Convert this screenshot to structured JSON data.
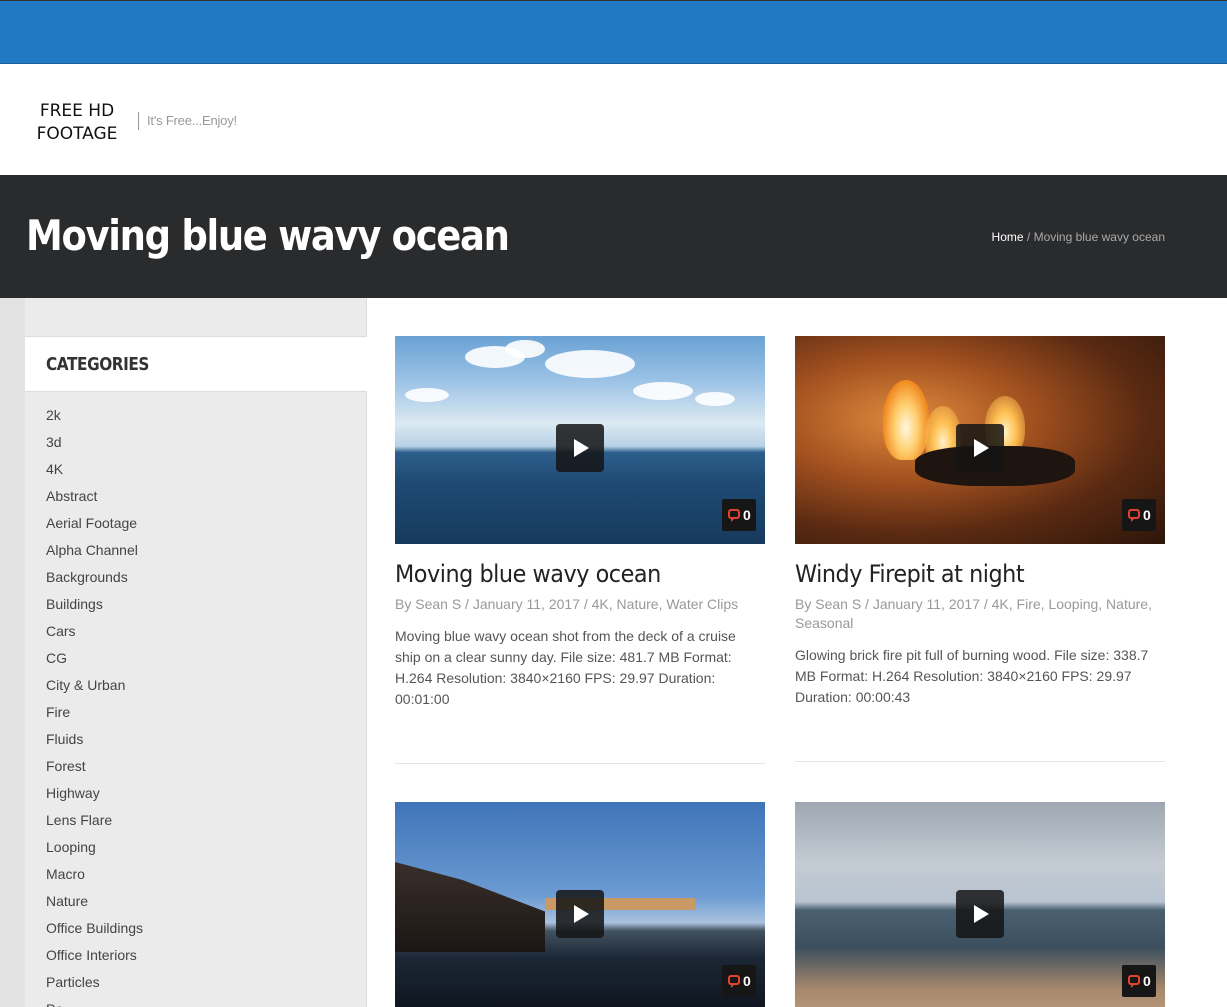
{
  "header": {
    "logo_line1": "FREE HD",
    "logo_line2": "FOOTAGE",
    "tagline": "It's Free...Enjoy!"
  },
  "title_bar": {
    "page_title": "Moving blue wavy ocean",
    "breadcrumb_home": "Home",
    "breadcrumb_separator": " / ",
    "breadcrumb_current": "Moving blue wavy ocean"
  },
  "sidebar": {
    "categories_title": "CATEGORIES",
    "categories": [
      "2k",
      "3d",
      "4K",
      "Abstract",
      "Aerial Footage",
      "Alpha Channel",
      "Backgrounds",
      "Buildings",
      "Cars",
      "CG",
      "City & Urban",
      "Fire",
      "Fluids",
      "Forest",
      "Highway",
      "Lens Flare",
      "Looping",
      "Macro",
      "Nature",
      "Office Buildings",
      "Office Interiors",
      "Particles",
      "Po..."
    ]
  },
  "posts": [
    {
      "title": "Moving blue wavy ocean",
      "meta": "By Sean S / January 11, 2017 / 4K, Nature, Water Clips",
      "description": "Moving blue wavy ocean shot from the deck of a cruise ship on a clear sunny day. File size: 481.7 MB Format: H.264 Resolution: 3840×2160 FPS: 29.97 Duration: 00:01:00",
      "comments": "0"
    },
    {
      "title": "Windy Firepit at night",
      "meta": "By Sean S / January 11, 2017 / 4K, Fire, Looping, Nature, Seasonal",
      "description": "Glowing brick fire pit full of burning wood. File size: 338.7 MB Format: H.264 Resolution: 3840×2160 FPS: 29.97 Duration: 00:00:43",
      "comments": "0"
    },
    {
      "comments": "0"
    },
    {
      "comments": "0"
    }
  ],
  "colors": {
    "top_bar": "#2079c2",
    "title_bar": "#2a2b2d",
    "comment_icon": "#e0442f"
  }
}
